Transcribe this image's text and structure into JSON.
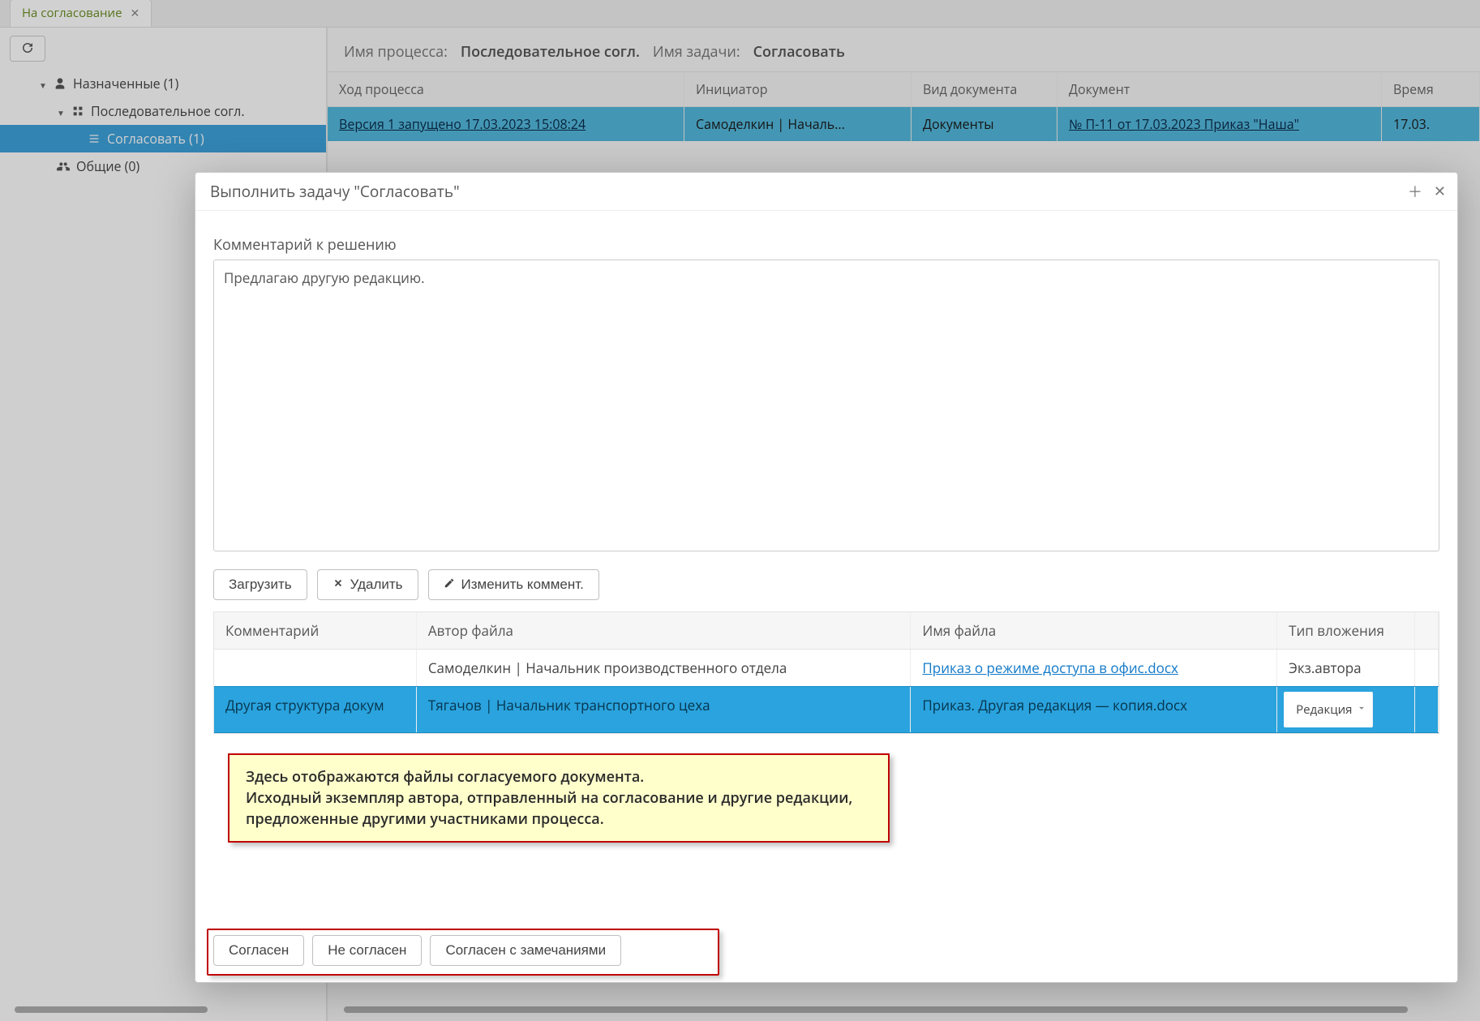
{
  "tab": {
    "title": "На согласование"
  },
  "tree": {
    "assigned": "Назначенные (1)",
    "seq": "Последовательное согл.",
    "approve": "Согласовать (1)",
    "shared": "Общие (0)"
  },
  "proc": {
    "name_lbl": "Имя процесса:",
    "name_val": "Последовательное согл.",
    "task_lbl": "Имя задачи:",
    "task_val": "Согласовать"
  },
  "grid": {
    "h_progress": "Ход процесса",
    "h_initiator": "Инициатор",
    "h_kind": "Вид документа",
    "h_doc": "Документ",
    "h_time": "Время",
    "rows": [
      {
        "progress": "Версия 1 запущено 17.03.2023 15:08:24",
        "initiator": "Самоделкин | Началь...",
        "kind": "Документы",
        "doc": "№ П-11 от 17.03.2023 Приказ \"Наша\"",
        "time": "17.03."
      }
    ]
  },
  "modal": {
    "title": "Выполнить задачу \"Согласовать\"",
    "comment_lbl": "Комментарий к решению",
    "comment_val": "Предлагаю другую редакцию.",
    "btn_upload": "Загрузить",
    "btn_delete": "Удалить",
    "btn_edit": "Изменить коммент.",
    "ft": {
      "h_comment": "Комментарий",
      "h_author": "Автор файла",
      "h_fname": "Имя файла",
      "h_atype": "Тип вложения"
    },
    "files": {
      "r0": {
        "comment": "",
        "author": "Самоделкин | Начальник производственного отдела",
        "fname": "Приказ о режиме доступа в офис.docx",
        "atype": "Экз.автора"
      },
      "r1": {
        "comment": "Другая структура докум",
        "author": "Тягачов | Начальник транспортного цеха",
        "fname": "Приказ. Другая редакция — копия.docx",
        "atype": "Редакция"
      }
    },
    "hint_l1": "Здесь отображаются файлы согласуемого документа.",
    "hint_l2": "Исходный экземпляр автора, отправленный на согласование и другие редакции, предложенные другими участниками процесса.",
    "btn_agree": "Согласен",
    "btn_disagree": "Не согласен",
    "btn_agree_notes": "Согласен с замечаниями"
  }
}
